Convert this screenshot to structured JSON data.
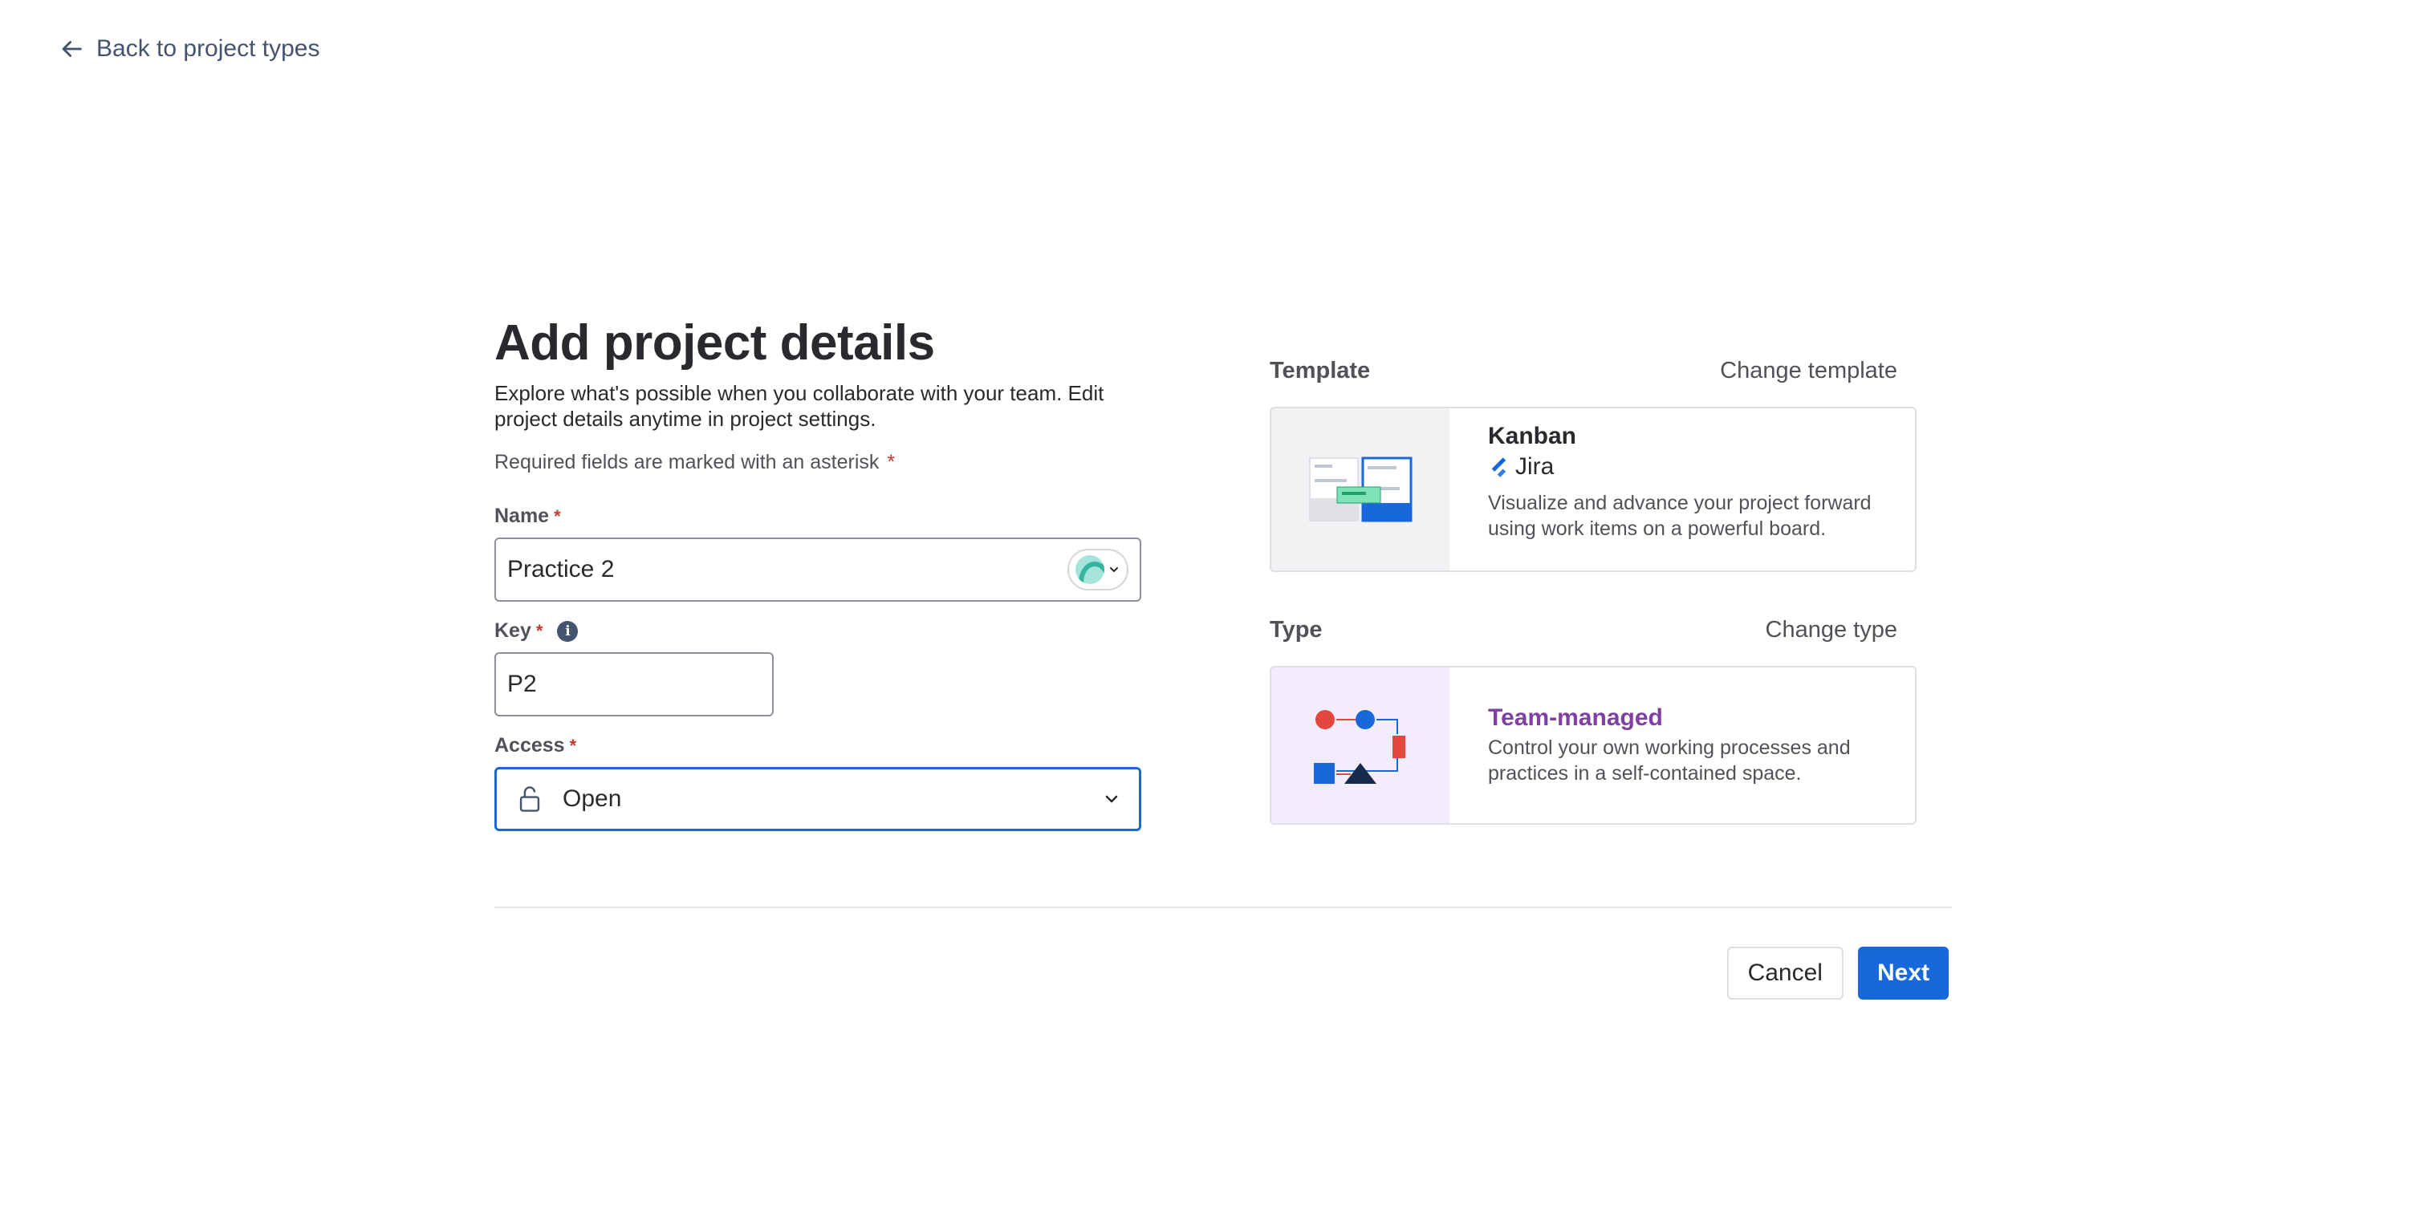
{
  "nav": {
    "back_label": "Back to project types"
  },
  "form": {
    "title": "Add project details",
    "subtitle": "Explore what's possible when you collaborate with your team. Edit project details anytime in project settings.",
    "required_note": "Required fields are marked with an asterisk",
    "asterisk": "*",
    "name": {
      "label": "Name",
      "value": "Practice 2"
    },
    "key": {
      "label": "Key",
      "value": "P2"
    },
    "access": {
      "label": "Access",
      "value": "Open"
    }
  },
  "template": {
    "section_title": "Template",
    "change_label": "Change template",
    "name": "Kanban",
    "product": "Jira",
    "description": "Visualize and advance your project forward using work items on a powerful board."
  },
  "type": {
    "section_title": "Type",
    "change_label": "Change type",
    "name": "Team-managed",
    "description": "Control your own working processes and practices in a self-contained space."
  },
  "actions": {
    "cancel_label": "Cancel",
    "next_label": "Next"
  },
  "colors": {
    "primary": "#1868db",
    "required": "#c9372c",
    "team_managed": "#803fa5"
  }
}
